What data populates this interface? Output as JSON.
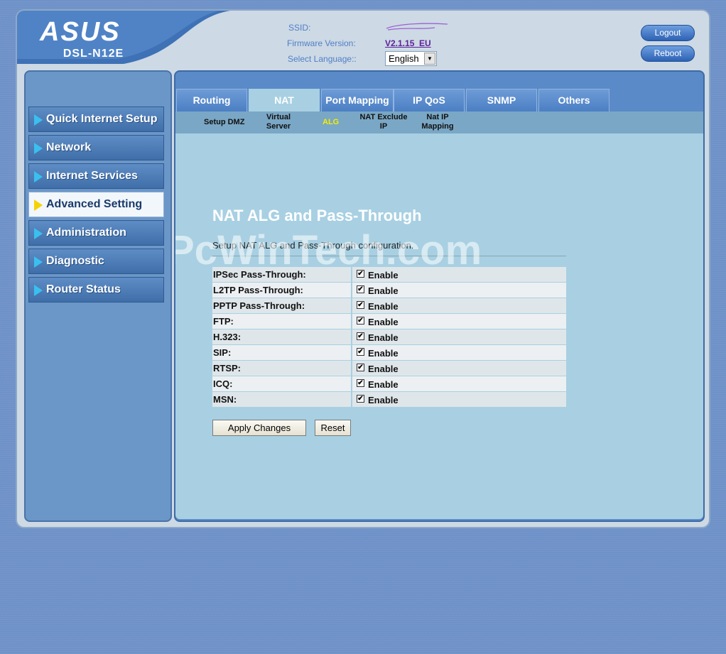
{
  "brand": {
    "logo": "ASUS",
    "model": "DSL-N12E"
  },
  "header": {
    "ssid_label": "SSID:",
    "firmware_label": "Firmware Version:",
    "firmware_value": "V2.1.15_EU",
    "language_label": "Select Language::",
    "language_value": "English",
    "logout": "Logout",
    "reboot": "Reboot"
  },
  "sidebar": {
    "items": [
      {
        "label": "Quick Internet Setup",
        "active": false
      },
      {
        "label": "Network",
        "active": false
      },
      {
        "label": "Internet Services",
        "active": false
      },
      {
        "label": "Advanced Setting",
        "active": true
      },
      {
        "label": "Administration",
        "active": false
      },
      {
        "label": "Diagnostic",
        "active": false
      },
      {
        "label": "Router Status",
        "active": false
      }
    ]
  },
  "tabs": [
    {
      "label": "Routing",
      "active": false
    },
    {
      "label": "NAT",
      "active": true
    },
    {
      "label": "Port Mapping",
      "active": false
    },
    {
      "label": "IP QoS",
      "active": false
    },
    {
      "label": "SNMP",
      "active": false
    },
    {
      "label": "Others",
      "active": false
    }
  ],
  "subtabs": [
    {
      "label": "Setup DMZ",
      "active": false
    },
    {
      "label": "Virtual Server",
      "active": false
    },
    {
      "label": "ALG",
      "active": true
    },
    {
      "label": "NAT Exclude IP",
      "active": false
    },
    {
      "label": "Nat IP Mapping",
      "active": false
    }
  ],
  "page": {
    "title": "NAT ALG and Pass-Through",
    "description": "Setup NAT ALG and Pass-Through configuration."
  },
  "watermark": "PcWinTech.com",
  "alg_rows": [
    {
      "label": "IPSec Pass-Through:",
      "enabled": true,
      "enable_label": "Enable"
    },
    {
      "label": "L2TP Pass-Through:",
      "enabled": true,
      "enable_label": "Enable"
    },
    {
      "label": "PPTP Pass-Through:",
      "enabled": true,
      "enable_label": "Enable"
    },
    {
      "label": "FTP:",
      "enabled": true,
      "enable_label": "Enable"
    },
    {
      "label": "H.323:",
      "enabled": true,
      "enable_label": "Enable"
    },
    {
      "label": "SIP:",
      "enabled": true,
      "enable_label": "Enable"
    },
    {
      "label": "RTSP:",
      "enabled": true,
      "enable_label": "Enable"
    },
    {
      "label": "ICQ:",
      "enabled": true,
      "enable_label": "Enable"
    },
    {
      "label": "MSN:",
      "enabled": true,
      "enable_label": "Enable"
    }
  ],
  "buttons": {
    "apply": "Apply Changes",
    "reset": "Reset"
  },
  "colors": {
    "page_bg": "#6e91c8",
    "content_bg": "#a8d0e2",
    "active_subtab": "#f4ee00",
    "active_sidebar_marker": "#f4d400",
    "sidebar_marker": "#3ac0ee",
    "firmware_link": "#5c1f9a"
  },
  "icons": {
    "sidebar_marker": "triangle-right-icon",
    "select_arrow": "chevron-down-icon",
    "checkbox": "checkmark-icon"
  }
}
